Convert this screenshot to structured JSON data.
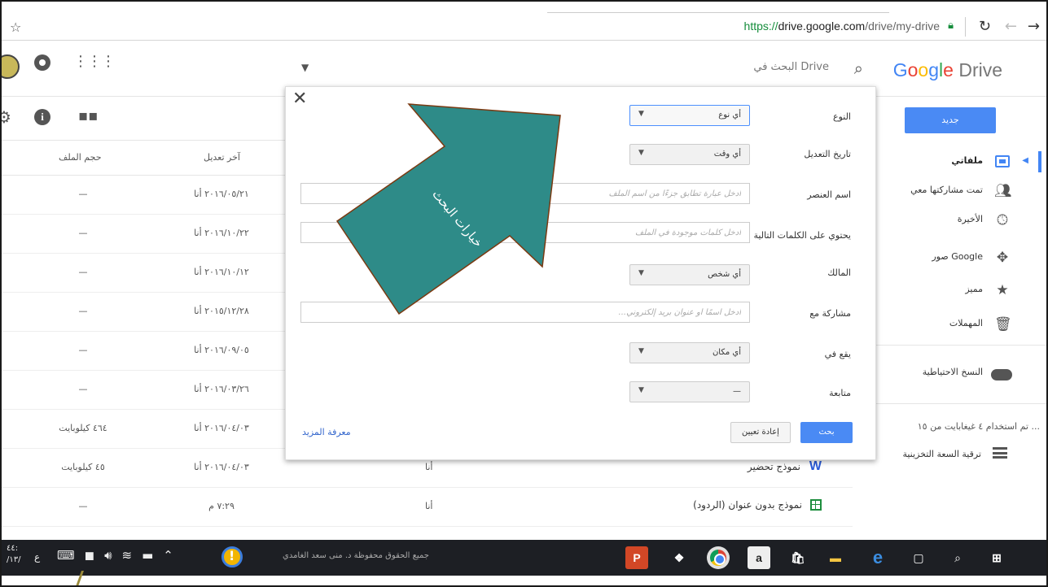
{
  "browser": {
    "url_scheme": "https://",
    "url_host": "drive.google.com",
    "url_path": "/drive/my-drive",
    "star_icon": "star-icon",
    "lock_icon": "lock-icon"
  },
  "header": {
    "logo_google": "Google",
    "logo_drive": "Drive",
    "search_placeholder": "البحث في Drive"
  },
  "sidebar": {
    "new_button": "جديد",
    "items": [
      {
        "label": "ملفاتي",
        "icon": "my-drive-icon",
        "active": true
      },
      {
        "label": "تمت مشاركتها معي",
        "icon": "people-icon"
      },
      {
        "label": "الأخيرة",
        "icon": "clock-icon"
      },
      {
        "label": "صور Google",
        "icon": "pinwheel-icon"
      },
      {
        "label": "مميز",
        "icon": "star-icon"
      },
      {
        "label": "المهملات",
        "icon": "trash-icon"
      },
      {
        "label": "النسخ الاحتياطية",
        "icon": "cloud-icon"
      }
    ],
    "storage_text": "تم استخدام ٤ غيغابايت من ١٥ ...",
    "upgrade_label": "ترقية السعة التخزينية"
  },
  "list": {
    "col_size": "حجم الملف",
    "col_modified": "آخر تعديل",
    "rows": [
      {
        "size": "—",
        "modified": "٢٠١٦/٠٥/٢١ أنا",
        "owner": "",
        "name": ""
      },
      {
        "size": "—",
        "modified": "٢٠١٦/١٠/٢٢ أنا",
        "owner": "",
        "name": ""
      },
      {
        "size": "—",
        "modified": "٢٠١٦/١٠/١٢ أنا",
        "owner": "",
        "name": ""
      },
      {
        "size": "—",
        "modified": "٢٠١٥/١٢/٢٨ أنا",
        "owner": "",
        "name": ""
      },
      {
        "size": "—",
        "modified": "٢٠١٦/٠٩/٠٥ أنا",
        "owner": "",
        "name": ""
      },
      {
        "size": "—",
        "modified": "٢٠١٦/٠٣/٢٦ أنا",
        "owner": "",
        "name": ""
      },
      {
        "size": "٤٦٤ كيلوبايت",
        "modified": "٢٠١٦/٠٤/٠٣ أنا",
        "owner": "",
        "name": ""
      },
      {
        "size": "٤٥ كيلوبايت",
        "modified": "٢٠١٦/٠٤/٠٣ أنا",
        "owner": "أنا",
        "name": "نموذج تحضير",
        "icon": "word-doc-icon"
      },
      {
        "size": "—",
        "modified": "٧:٢٩ م",
        "owner": "أنا",
        "name": "نموذج بدون عنوان (الردود)",
        "icon": "sheets-icon"
      }
    ]
  },
  "panel": {
    "fields": [
      {
        "label": "النوع",
        "value": "أي نوع",
        "kind": "select"
      },
      {
        "label": "تاريخ التعديل",
        "value": "أي وقت",
        "kind": "select"
      },
      {
        "label": "اسم العنصر",
        "placeholder": "ادخل عبارة تطابق جزءًا من اسم الملف",
        "kind": "text"
      },
      {
        "label": "يحتوي على الكلمات التالية",
        "placeholder": "ادخل كلمات موجودة في الملف",
        "kind": "text"
      },
      {
        "label": "المالك",
        "value": "أي شخص",
        "kind": "select"
      },
      {
        "label": "مشاركة مع",
        "placeholder": "أدخل اسمًا أو عنوان بريد إلكتروني...",
        "kind": "text"
      },
      {
        "label": "يقع في",
        "value": "أي مكان",
        "kind": "select"
      },
      {
        "label": "متابعة",
        "value": "—",
        "kind": "select"
      }
    ],
    "search_button": "بحث",
    "reset_button": "إعادة تعيين",
    "learn_more": "معرفة المزيد",
    "overlay_text": "خيارات البحث",
    "overlay_color": "#2e8b88"
  },
  "taskbar": {
    "time_line1": "٤٤:",
    "time_line2": "/١٣/",
    "lang": "ع",
    "copyright": "جميع الحقوق محفوظة د. منى سعد الغامدي",
    "apps": [
      "powerpoint-icon",
      "dropbox-icon",
      "chrome-icon",
      "amazon-icon",
      "store-icon",
      "file-explorer-icon",
      "edge-icon",
      "task-view-icon",
      "search-icon",
      "start-icon"
    ]
  }
}
